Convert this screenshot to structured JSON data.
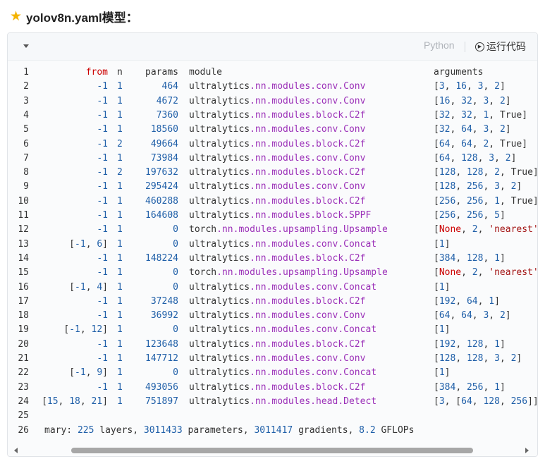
{
  "heading": {
    "icon": "star-icon",
    "text": "yolov8n.yaml模型："
  },
  "toolbar": {
    "language": "Python",
    "run_label": "运行代码"
  },
  "header_row": {
    "num": "1",
    "from": "from",
    "n": "n",
    "params": "params",
    "module": "module",
    "arguments": "arguments"
  },
  "rows": [
    {
      "num": "2",
      "from": "-1",
      "n": "1",
      "params": "464",
      "m1": "ultralytics",
      "m2": ".nn.modules.conv.",
      "m3": "Conv",
      "args": "[3, 16, 3, 2]"
    },
    {
      "num": "3",
      "from": "-1",
      "n": "1",
      "params": "4672",
      "m1": "ultralytics",
      "m2": ".nn.modules.conv.",
      "m3": "Conv",
      "args": "[16, 32, 3, 2]"
    },
    {
      "num": "4",
      "from": "-1",
      "n": "1",
      "params": "7360",
      "m1": "ultralytics",
      "m2": ".nn.modules.block.",
      "m3": "C2f",
      "args": "[32, 32, 1, True]"
    },
    {
      "num": "5",
      "from": "-1",
      "n": "1",
      "params": "18560",
      "m1": "ultralytics",
      "m2": ".nn.modules.conv.",
      "m3": "Conv",
      "args": "[32, 64, 3, 2]"
    },
    {
      "num": "6",
      "from": "-1",
      "n": "2",
      "params": "49664",
      "m1": "ultralytics",
      "m2": ".nn.modules.block.",
      "m3": "C2f",
      "args": "[64, 64, 2, True]"
    },
    {
      "num": "7",
      "from": "-1",
      "n": "1",
      "params": "73984",
      "m1": "ultralytics",
      "m2": ".nn.modules.conv.",
      "m3": "Conv",
      "args": "[64, 128, 3, 2]"
    },
    {
      "num": "8",
      "from": "-1",
      "n": "2",
      "params": "197632",
      "m1": "ultralytics",
      "m2": ".nn.modules.block.",
      "m3": "C2f",
      "args": "[128, 128, 2, True]"
    },
    {
      "num": "9",
      "from": "-1",
      "n": "1",
      "params": "295424",
      "m1": "ultralytics",
      "m2": ".nn.modules.conv.",
      "m3": "Conv",
      "args": "[128, 256, 3, 2]"
    },
    {
      "num": "10",
      "from": "-1",
      "n": "1",
      "params": "460288",
      "m1": "ultralytics",
      "m2": ".nn.modules.block.",
      "m3": "C2f",
      "args": "[256, 256, 1, True]"
    },
    {
      "num": "11",
      "from": "-1",
      "n": "1",
      "params": "164608",
      "m1": "ultralytics",
      "m2": ".nn.modules.block.",
      "m3": "SPPF",
      "args": "[256, 256, 5]"
    },
    {
      "num": "12",
      "from": "-1",
      "n": "1",
      "params": "0",
      "m1": "torch",
      "m2": ".nn.modules.upsampling.",
      "m3": "Upsample",
      "args": "[None, 2, 'nearest'"
    },
    {
      "num": "13",
      "from": "[-1, 6]",
      "n": "1",
      "params": "0",
      "m1": "ultralytics",
      "m2": ".nn.modules.conv.",
      "m3": "Concat",
      "args": "[1]"
    },
    {
      "num": "14",
      "from": "-1",
      "n": "1",
      "params": "148224",
      "m1": "ultralytics",
      "m2": ".nn.modules.block.",
      "m3": "C2f",
      "args": "[384, 128, 1]"
    },
    {
      "num": "15",
      "from": "-1",
      "n": "1",
      "params": "0",
      "m1": "torch",
      "m2": ".nn.modules.upsampling.",
      "m3": "Upsample",
      "args": "[None, 2, 'nearest'"
    },
    {
      "num": "16",
      "from": "[-1, 4]",
      "n": "1",
      "params": "0",
      "m1": "ultralytics",
      "m2": ".nn.modules.conv.",
      "m3": "Concat",
      "args": "[1]"
    },
    {
      "num": "17",
      "from": "-1",
      "n": "1",
      "params": "37248",
      "m1": "ultralytics",
      "m2": ".nn.modules.block.",
      "m3": "C2f",
      "args": "[192, 64, 1]"
    },
    {
      "num": "18",
      "from": "-1",
      "n": "1",
      "params": "36992",
      "m1": "ultralytics",
      "m2": ".nn.modules.conv.",
      "m3": "Conv",
      "args": "[64, 64, 3, 2]"
    },
    {
      "num": "19",
      "from": "[-1, 12]",
      "n": "1",
      "params": "0",
      "m1": "ultralytics",
      "m2": ".nn.modules.conv.",
      "m3": "Concat",
      "args": "[1]"
    },
    {
      "num": "20",
      "from": "-1",
      "n": "1",
      "params": "123648",
      "m1": "ultralytics",
      "m2": ".nn.modules.block.",
      "m3": "C2f",
      "args": "[192, 128, 1]"
    },
    {
      "num": "21",
      "from": "-1",
      "n": "1",
      "params": "147712",
      "m1": "ultralytics",
      "m2": ".nn.modules.conv.",
      "m3": "Conv",
      "args": "[128, 128, 3, 2]"
    },
    {
      "num": "22",
      "from": "[-1, 9]",
      "n": "1",
      "params": "0",
      "m1": "ultralytics",
      "m2": ".nn.modules.conv.",
      "m3": "Concat",
      "args": "[1]"
    },
    {
      "num": "23",
      "from": "-1",
      "n": "1",
      "params": "493056",
      "m1": "ultralytics",
      "m2": ".nn.modules.block.",
      "m3": "C2f",
      "args": "[384, 256, 1]"
    },
    {
      "num": "24",
      "from": "[15, 18, 21]",
      "n": "1",
      "params": "751897",
      "m1": "ultralytics",
      "m2": ".nn.modules.head.",
      "m3": "Detect",
      "args": "[3, [64, 128, 256]]"
    }
  ],
  "empty_line": {
    "num": "25"
  },
  "summary": {
    "num": "26",
    "text": "mary: 225 layers, 3011433 parameters, 3011417 gradients, 8.2 GFLOPs"
  },
  "colors": {
    "number": "#1f5fa8",
    "keyword": "#cc0000",
    "module_path": "#9b30b8",
    "accent_star": "#f4b400"
  }
}
